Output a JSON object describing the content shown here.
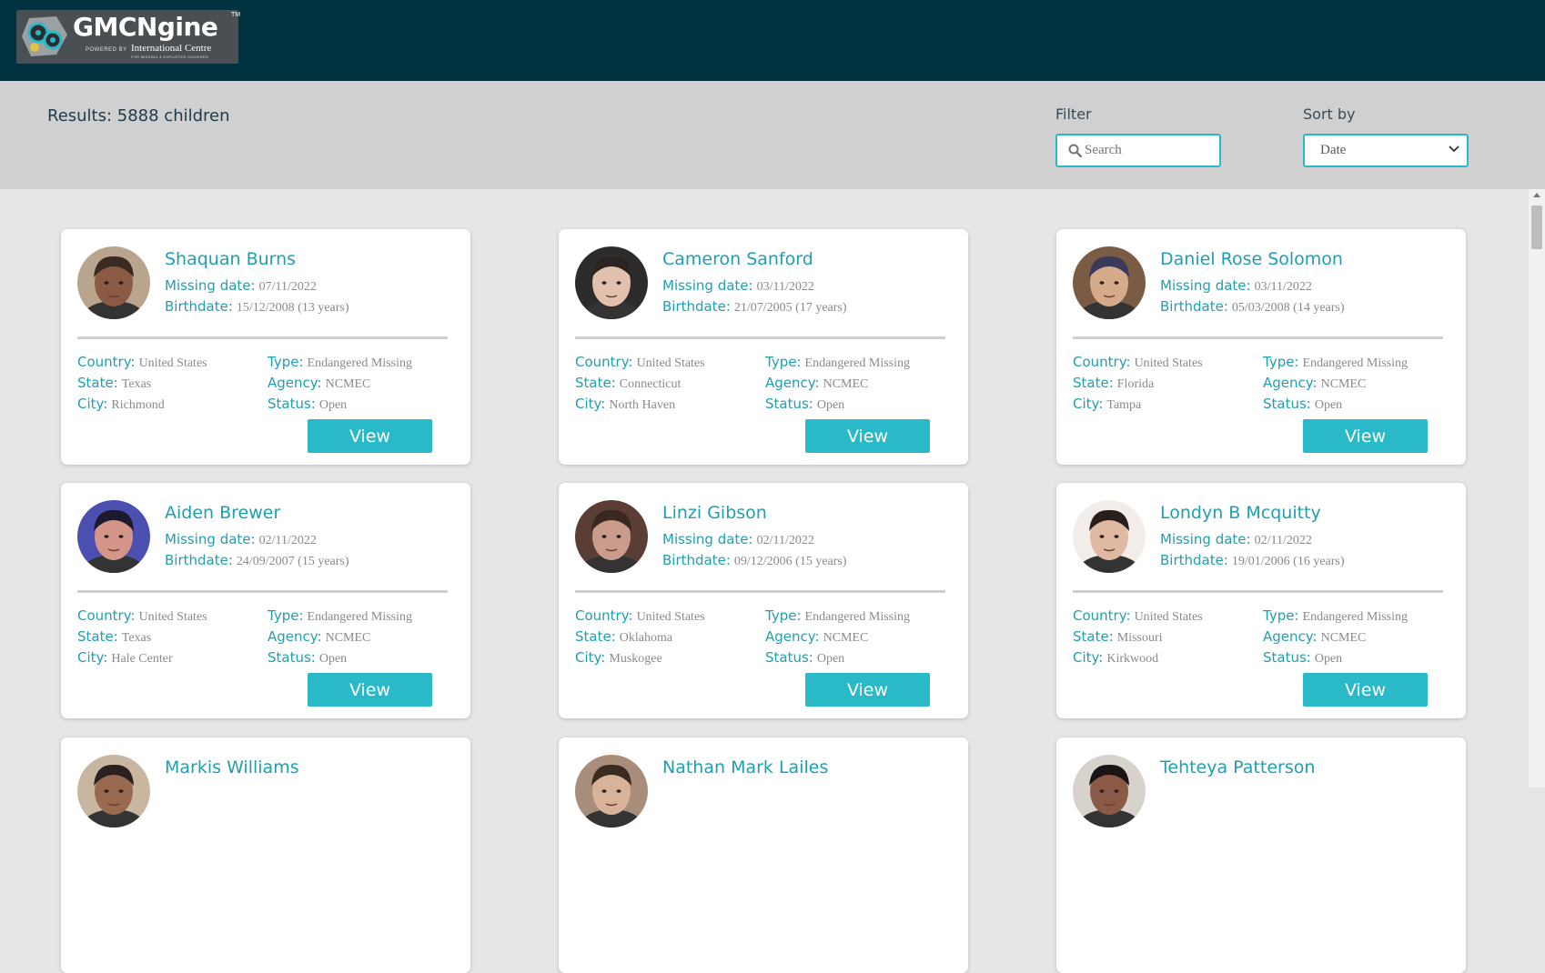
{
  "header": {
    "logo_title": "GMCNgine",
    "logo_tm": "TM",
    "logo_powered": "POWERED BY",
    "logo_org": "International Centre",
    "logo_org_sub": "FOR MISSING & EXPLOITED CHILDREN"
  },
  "filters": {
    "results_text": "Results: 5888 children",
    "filter_label": "Filter",
    "search_placeholder": "Search",
    "sort_label": "Sort by",
    "sort_value": "Date"
  },
  "labels": {
    "missing_date": "Missing date:",
    "birthdate": "Birthdate:",
    "country": "Country:",
    "state": "State:",
    "city": "City:",
    "type": "Type:",
    "agency": "Agency:",
    "status": "Status:",
    "view": "View"
  },
  "cards": [
    {
      "name": "Shaquan Burns",
      "missing_date": "07/11/2022",
      "birthdate": "15/12/2008 (13 years)",
      "country": "United States",
      "state": "Texas",
      "city": "Richmond",
      "type": "Endangered Missing",
      "agency": "NCMEC",
      "status": "Open",
      "skin": "#8a5a44",
      "hair": "#3a2a22",
      "bg": "#b9a58e"
    },
    {
      "name": "Cameron Sanford",
      "missing_date": "03/11/2022",
      "birthdate": "21/07/2005 (17 years)",
      "country": "United States",
      "state": "Connecticut",
      "city": "North Haven",
      "type": "Endangered Missing",
      "agency": "NCMEC",
      "status": "Open",
      "skin": "#e1c1ad",
      "hair": "#2a2422",
      "bg": "#2c2c2c"
    },
    {
      "name": "Daniel Rose Solomon",
      "missing_date": "03/11/2022",
      "birthdate": "05/03/2008 (14 years)",
      "country": "United States",
      "state": "Florida",
      "city": "Tampa",
      "type": "Endangered Missing",
      "agency": "NCMEC",
      "status": "Open",
      "skin": "#d6ab8c",
      "hair": "#3b3a5a",
      "bg": "#7a5c45"
    },
    {
      "name": "Aiden Brewer",
      "missing_date": "02/11/2022",
      "birthdate": "24/09/2007 (15 years)",
      "country": "United States",
      "state": "Texas",
      "city": "Hale Center",
      "type": "Endangered Missing",
      "agency": "NCMEC",
      "status": "Open",
      "skin": "#d5968a",
      "hair": "#1e1a2e",
      "bg": "#4a4fb0"
    },
    {
      "name": "Linzi Gibson",
      "missing_date": "02/11/2022",
      "birthdate": "09/12/2006 (15 years)",
      "country": "United States",
      "state": "Oklahoma",
      "city": "Muskogee",
      "type": "Endangered Missing",
      "agency": "NCMEC",
      "status": "Open",
      "skin": "#c99c8c",
      "hair": "#3a2722",
      "bg": "#5a3d35"
    },
    {
      "name": "Londyn B Mcquitty",
      "missing_date": "02/11/2022",
      "birthdate": "19/01/2006 (16 years)",
      "country": "United States",
      "state": "Missouri",
      "city": "Kirkwood",
      "type": "Endangered Missing",
      "agency": "NCMEC",
      "status": "Open",
      "skin": "#e0b9a3",
      "hair": "#2a1e1a",
      "bg": "#f2ede8"
    },
    {
      "name": "Markis Williams",
      "skin": "#9a6a50",
      "hair": "#2a2020",
      "bg": "#c9b6a0"
    },
    {
      "name": "Nathan Mark Lailes",
      "skin": "#d9b29a",
      "hair": "#3a2a20",
      "bg": "#a88e7a"
    },
    {
      "name": "Tehteya Patterson",
      "skin": "#8a5a46",
      "hair": "#1a1414",
      "bg": "#d8d2cc"
    }
  ]
}
